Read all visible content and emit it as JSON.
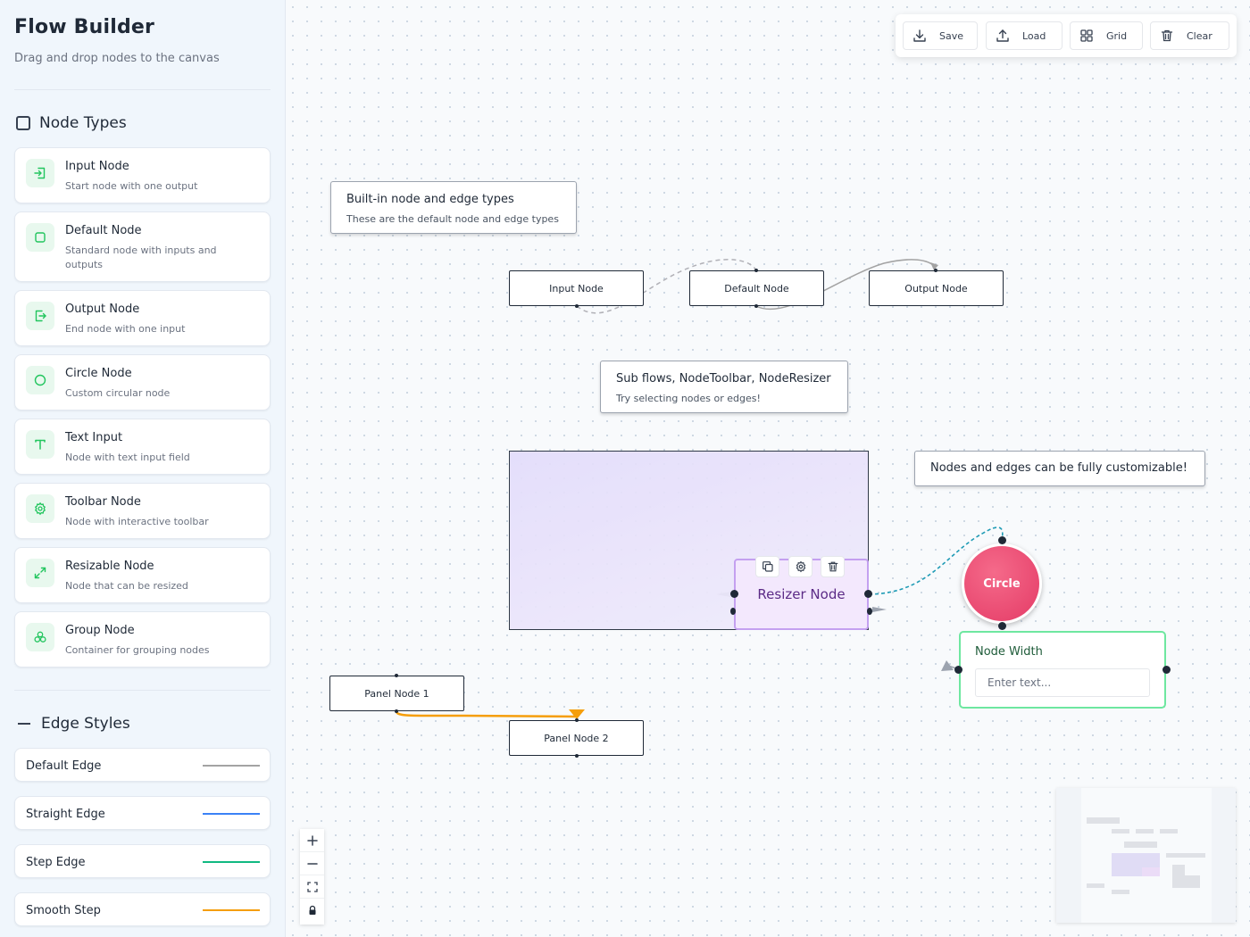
{
  "sidebar": {
    "title": "Flow Builder",
    "subtitle": "Drag and drop nodes to the canvas",
    "node_types_heading": "Node Types",
    "node_types": [
      {
        "title": "Input Node",
        "desc": "Start node with one output",
        "icon": "input-icon"
      },
      {
        "title": "Default Node",
        "desc": "Standard node with inputs and outputs",
        "icon": "square-icon"
      },
      {
        "title": "Output Node",
        "desc": "End node with one input",
        "icon": "output-icon"
      },
      {
        "title": "Circle Node",
        "desc": "Custom circular node",
        "icon": "circle-icon"
      },
      {
        "title": "Text Input",
        "desc": "Node with text input field",
        "icon": "text-icon"
      },
      {
        "title": "Toolbar Node",
        "desc": "Node with interactive toolbar",
        "icon": "gear-icon"
      },
      {
        "title": "Resizable Node",
        "desc": "Node that can be resized",
        "icon": "resize-icon"
      },
      {
        "title": "Group Node",
        "desc": "Container for grouping nodes",
        "icon": "group-icon"
      }
    ],
    "edge_styles_heading": "Edge Styles",
    "edge_styles": [
      {
        "label": "Default Edge",
        "color": "#a3a3a3"
      },
      {
        "label": "Straight Edge",
        "color": "#3b82f6"
      },
      {
        "label": "Step Edge",
        "color": "#10b981"
      },
      {
        "label": "Smooth Step",
        "color": "#f59e0b"
      }
    ]
  },
  "toolbar": {
    "save": "Save",
    "load": "Load",
    "grid": "Grid",
    "clear": "Clear"
  },
  "canvas": {
    "label_builtin": {
      "title": "Built-in node and edge types",
      "sub": "These are the default node and edge types"
    },
    "label_subflows": {
      "title": "Sub flows, NodeToolbar, NodeResizer",
      "sub": "Try selecting nodes or edges!"
    },
    "label_custom": {
      "title": "Nodes and edges can be fully customizable!"
    },
    "input_node": "Input Node",
    "default_node": "Default Node",
    "output_node": "Output Node",
    "resizer_node": "Resizer Node",
    "circle_node": "Circle",
    "node_width": {
      "title": "Node Width",
      "placeholder": "Enter text..."
    },
    "panel_node_1": "Panel Node 1",
    "panel_node_2": "Panel Node 2"
  },
  "colors": {
    "accent_green": "#22c55e",
    "circle": "#e43b66",
    "resizer_border": "#c4a0f0",
    "edge_orange": "#f59e0b",
    "edge_teal": "#1f9bb5"
  }
}
